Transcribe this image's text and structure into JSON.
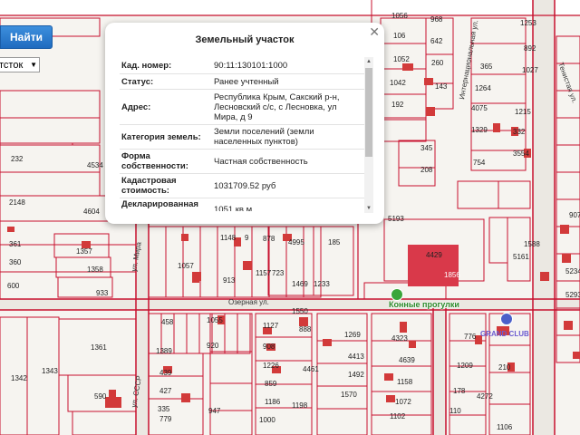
{
  "search": {
    "button_label": "Найти",
    "layer_select_value": "тсток"
  },
  "popup": {
    "title": "Земельный участок",
    "rows": [
      {
        "key": "Кад. номер:",
        "value": "90:11:130101:1000"
      },
      {
        "key": "Статус:",
        "value": "Ранее учтенный"
      },
      {
        "key": "Адрес:",
        "value": "Республика Крым, Сакский р-н, Лесновский с/с, с Лесновка, ул Мира, д 9"
      },
      {
        "key": "Категория земель:",
        "value": "Земли поселений (земли населенных пунктов)"
      },
      {
        "key": "Форма собственности:",
        "value": "Частная собственность"
      },
      {
        "key": "Кадастровая стоимость:",
        "value": "1031709.52 руб"
      },
      {
        "key": "Декларированная площадь:",
        "value": "1051 кв.м"
      }
    ]
  },
  "map": {
    "parcel_labels": [
      "968",
      "1056",
      "1253",
      "106",
      "642",
      "892",
      "1052",
      "260",
      "365",
      "1027",
      "1042",
      "143",
      "1264",
      "192",
      "4075",
      "1215",
      "1329",
      "332",
      "345",
      "754",
      "3554",
      "232",
      "4534",
      "208",
      "2148",
      "4604",
      "5193",
      "907",
      "361",
      "1357",
      "4995",
      "1148",
      "878",
      "185",
      "4429",
      "1856",
      "1588",
      "5161",
      "360",
      "1358",
      "1057",
      "913",
      "1157",
      "723",
      "1469",
      "1233",
      "5234",
      "600",
      "933",
      "5293",
      "458",
      "1055",
      "1550",
      "1127",
      "888",
      "1269",
      "4323",
      "776",
      "1361",
      "1389",
      "920",
      "908",
      "4413",
      "4639",
      "1226",
      "4461",
      "1492",
      "1209",
      "210",
      "4272",
      "1342",
      "1343",
      "439",
      "427",
      "859",
      "1570",
      "1158",
      "178",
      "590",
      "335",
      "947",
      "1186",
      "1198",
      "1072",
      "1102",
      "110",
      "779",
      "1000",
      "1106",
      "9"
    ],
    "street_labels": [
      "Озерная ул.",
      "Тенистая ул.",
      "ул. Мира",
      "Интернациональная ул.",
      "ул. СССР"
    ],
    "poi": [
      {
        "label": "Конные прогулки"
      },
      {
        "label": "GRAND CLUB"
      }
    ],
    "colors": {
      "parcel_line": "#c8102e",
      "building": "#d23a3a",
      "big_building": "#d9394a",
      "road": "#e9e6e0"
    }
  }
}
